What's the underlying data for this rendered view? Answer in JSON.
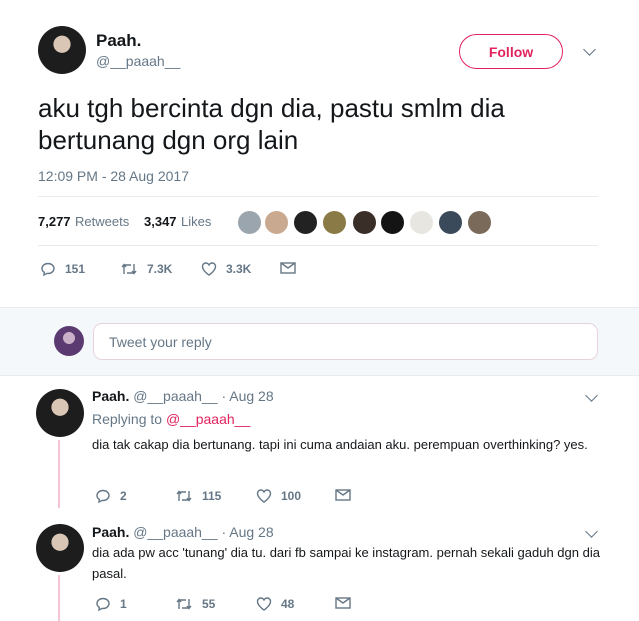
{
  "tweet": {
    "author_name": "Paah.",
    "author_handle": "@__paaah__",
    "follow_label": "Follow",
    "text": "aku tgh bercinta dgn dia, pastu smlm dia bertunang dgn org lain",
    "timestamp": "12:09 PM - 28 Aug 2017",
    "retweets_count": "7,277",
    "retweets_label": "Retweets",
    "likes_count": "3,347",
    "likes_label": "Likes",
    "actions": {
      "replies": "151",
      "retweets": "7.3K",
      "likes": "3.3K"
    }
  },
  "reply_box": {
    "placeholder": "Tweet your reply"
  },
  "replies": [
    {
      "author_name": "Paah.",
      "author_handle": "@__paaah__",
      "separator": "·",
      "date": "Aug 28",
      "replying_to_label": "Replying to",
      "replying_to_handle": "@__paaah__",
      "text": "dia tak cakap dia bertunang. tapi ini cuma andaian aku. perempuan overthinking? yes.",
      "replies": "2",
      "retweets": "115",
      "likes": "100"
    },
    {
      "author_name": "Paah.",
      "author_handle": "@__paaah__",
      "separator": "·",
      "date": "Aug 28",
      "text": "dia ada pw acc 'tunang' dia tu. dari fb sampai ke instagram. pernah sekali gaduh dgn dia pasal.",
      "replies": "1",
      "retweets": "55",
      "likes": "48"
    }
  ],
  "colors": {
    "accent": "#e0245e",
    "muted": "#657786",
    "thread": "#f7c4d6"
  },
  "icons": [
    "chevron-down-icon",
    "reply-icon",
    "retweet-icon",
    "heart-icon",
    "mail-icon"
  ]
}
